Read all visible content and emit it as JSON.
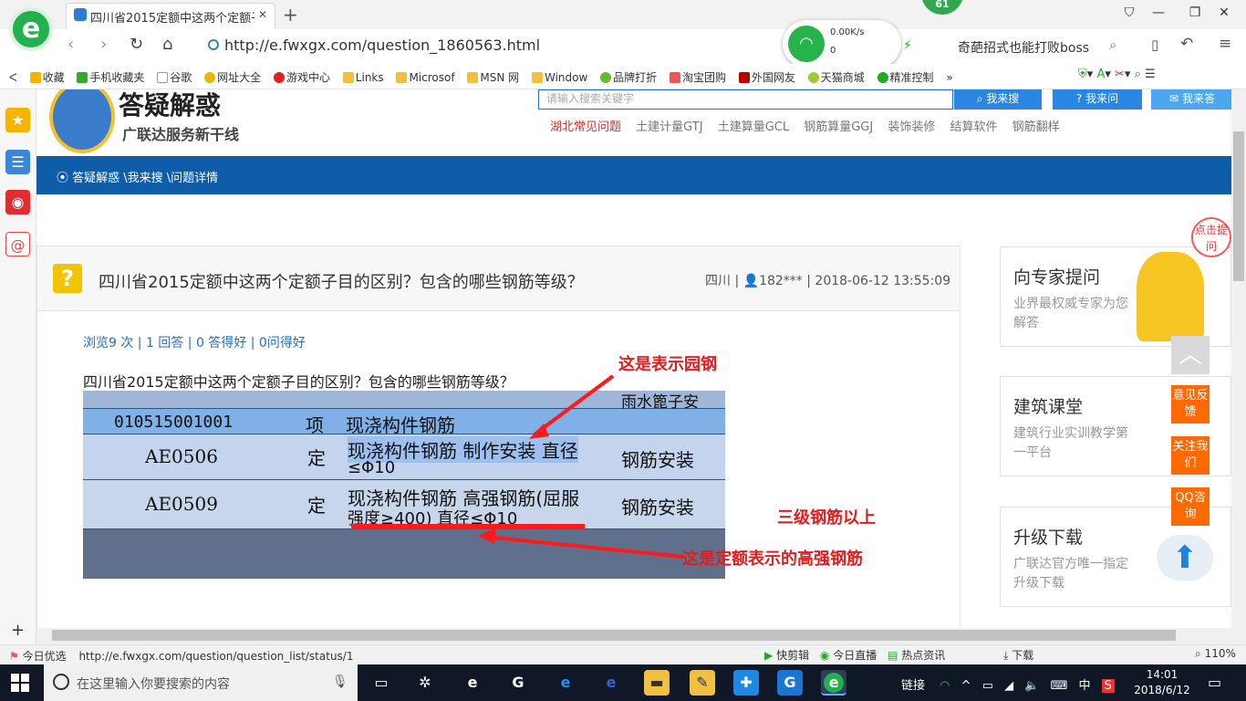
{
  "browser": {
    "tab_title": "四川省2015定额中这两个定额子",
    "url": "http://e.fwxgx.com/question_1860563.html",
    "net_speed": "0.00K/s",
    "net_count": "0",
    "badge": "61",
    "search_hint": "奇葩招式也能打败boss",
    "bookmarks": [
      "收藏",
      "手机收藏夹",
      "谷歌",
      "网址大全",
      "游戏中心",
      "Links",
      "Microsof",
      "MSN 网",
      "Window",
      "品牌打折",
      "淘宝团购",
      "外国网友",
      "天猫商城",
      "精准控制"
    ]
  },
  "site": {
    "logo_title": "答疑解惑",
    "logo_subtitle": "广联达服务新干线",
    "search_placeholder": "请输入搜索关键字",
    "btn_search": "我来搜",
    "btn_ask": "我来问",
    "btn_answer": "我来答",
    "categories": [
      "湖北常见问题",
      "土建计量GTJ",
      "土建算量GCL",
      "钢筋算量GGJ",
      "装饰装修",
      "结算软件",
      "钢筋翻样"
    ],
    "breadcrumb": "答疑解惑 \\我来搜 \\问题详情"
  },
  "question": {
    "title": "四川省2015定额中这两个定额子目的区别？包含的哪些钢筋等级？",
    "region": "四川",
    "user": "182***",
    "datetime": "2018-06-12 13:55:09",
    "stats": "浏览9 次 | 1 回答 | 0 答得好 | 0问得好",
    "body": "四川省2015定额中这两个定额子目的区别？包含的哪些钢筋等级？",
    "photo": {
      "top_right": "雨水篦子安",
      "row1": [
        "010515001001",
        "项",
        "现浇构件钢筋"
      ],
      "row2": [
        "AE0506",
        "定",
        "现浇构件钢筋 制作安装 直径",
        "≤Φ10",
        "钢筋安装"
      ],
      "row3": [
        "AE0509",
        "定",
        "现浇构件钢筋 高强钢筋(屈服",
        "强度≥400) 直径≤Φ10",
        "钢筋安装"
      ]
    },
    "annotations": {
      "round_steel": "这是表示园钢",
      "grade3": "三级钢筋以上",
      "high_strength": "这是定额表示的高强钢筋"
    }
  },
  "sidebar": {
    "cards": [
      {
        "title": "向专家提问",
        "sub": "业界最权威专家为您解答"
      },
      {
        "title": "建筑课堂",
        "sub": "建筑行业实训教学第一平台"
      },
      {
        "title": "升级下载",
        "sub": "广联达官方唯一指定升级下载"
      }
    ],
    "float_tag": "点击提问",
    "float_buttons": [
      "意见反馈",
      "关注我们",
      "QQ咨询"
    ]
  },
  "statusbar": {
    "left": "今日优选",
    "link": "http://e.fwxgx.com/question/question_list/status/1",
    "items": [
      "快剪辑",
      "今日直播",
      "热点资讯",
      "下载"
    ],
    "zoom": "110%"
  },
  "taskbar": {
    "search_placeholder": "在这里输入你要搜索的内容",
    "tray_link": "链接",
    "ime": "中",
    "time": "14:01",
    "date": "2018/6/12"
  },
  "colors": {
    "brand_blue": "#0f5ca9",
    "accent_orange": "#ff6a00",
    "annotation_red": "#e01e1e"
  }
}
